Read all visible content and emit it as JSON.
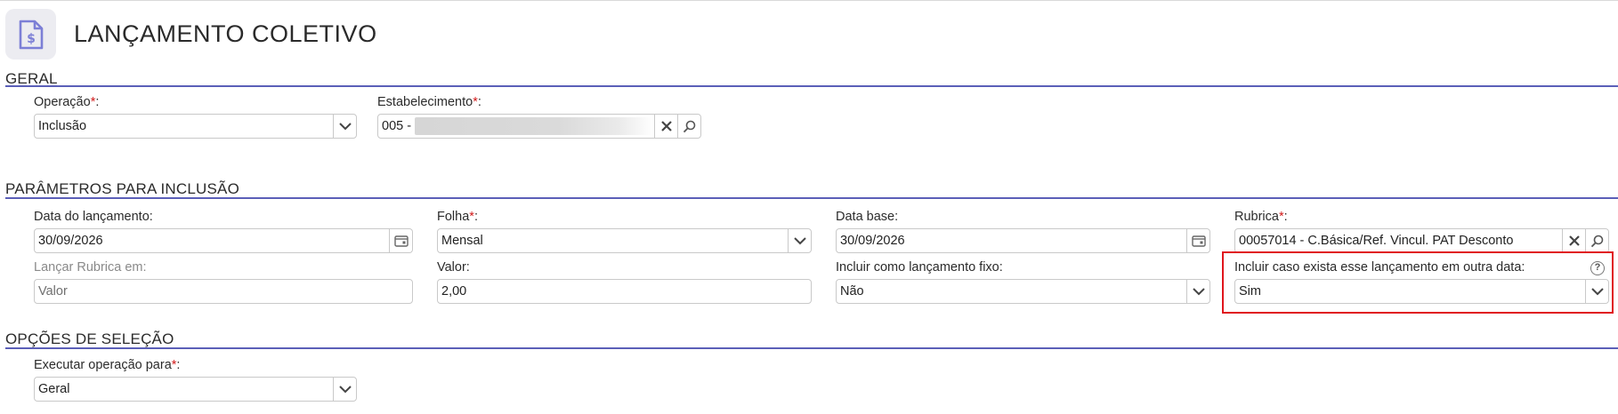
{
  "page": {
    "title": "LANÇAMENTO COLETIVO",
    "icon": "document-dollar-icon"
  },
  "sections": {
    "geral": {
      "title": "GERAL",
      "operacao": {
        "label": "Operação",
        "required_mark": "*",
        "suffix": ":",
        "value": "Inclusão"
      },
      "estabelecimento": {
        "label": "Estabelecimento",
        "required_mark": "*",
        "suffix": ":",
        "value": "005 -"
      }
    },
    "parametros": {
      "title": "PARÂMETROS PARA INCLUSÃO",
      "data_lancamento": {
        "label": "Data do lançamento:",
        "value": "30/09/2026"
      },
      "folha": {
        "label": "Folha",
        "required_mark": "*",
        "suffix": ":",
        "value": "Mensal"
      },
      "data_base": {
        "label": "Data base:",
        "value": "30/09/2026"
      },
      "rubrica": {
        "label": "Rubrica",
        "required_mark": "*",
        "suffix": ":",
        "value": "00057014 - C.Básica/Ref. Vincul. PAT Desconto"
      },
      "lancar_rubrica": {
        "label": "Lançar Rubrica em:",
        "value": "Valor"
      },
      "valor": {
        "label": "Valor:",
        "value": "2,00"
      },
      "incluir_fixo": {
        "label": "Incluir como lançamento fixo:",
        "value": "Não"
      },
      "incluir_outra_data": {
        "label": "Incluir caso exista esse lançamento em outra data:",
        "value": "Sim",
        "help": "?"
      }
    },
    "opcoes": {
      "title": "OPÇÕES DE SELEÇÃO",
      "executar_para": {
        "label": "Executar operação para",
        "required_mark": "*",
        "suffix": ":",
        "value": "Geral"
      }
    }
  },
  "colors": {
    "accent": "#5b5fb8",
    "icon_accent": "#7c7fd6",
    "required": "#d11a1a",
    "highlight": "#e0161d"
  }
}
